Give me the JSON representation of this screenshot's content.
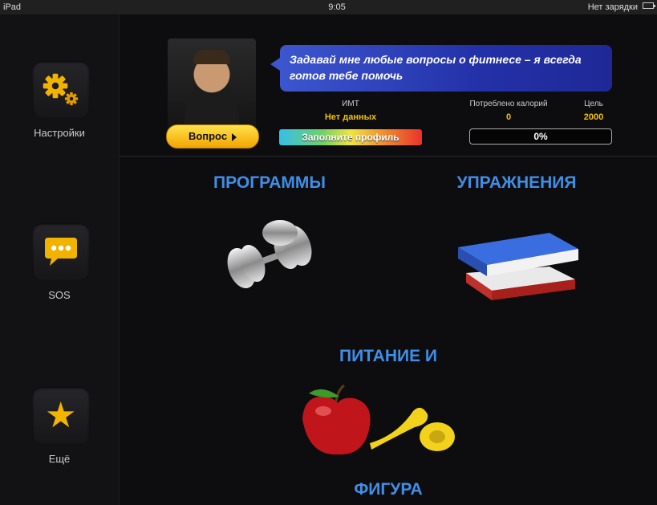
{
  "status_bar": {
    "device": "iPad",
    "time": "9:05",
    "battery_text": "Нет зарядки"
  },
  "sidebar": {
    "items": [
      {
        "label": "Настройки",
        "icon": "gear-icon"
      },
      {
        "label": "SOS",
        "icon": "chat-bubble-icon"
      },
      {
        "label": "Ещё",
        "icon": "star-icon"
      }
    ]
  },
  "coach": {
    "question_button": "Вопрос",
    "speech": "Задавай мне любые вопросы о фитнесе – я всегда готов тебе помочь"
  },
  "stats": {
    "bmi_label": "ИМТ",
    "bmi_value": "Нет данных",
    "fill_profile": "Заполните профиль",
    "calories_label": "Потреблено калорий",
    "calories_value": "0",
    "goal_label": "Цель",
    "goal_value": "2000",
    "progress_text": "0%",
    "progress_fraction": 0
  },
  "tiles": {
    "programs": "ПРОГРАММЫ",
    "exercises": "УПРАЖНЕНИЯ",
    "nutrition_top": "ПИТАНИЕ И",
    "nutrition_bottom": "ФИГУРА"
  },
  "colors": {
    "accent_blue": "#3f8fe8",
    "accent_yellow": "#f2c200",
    "speech_blue": "#2331a8"
  }
}
